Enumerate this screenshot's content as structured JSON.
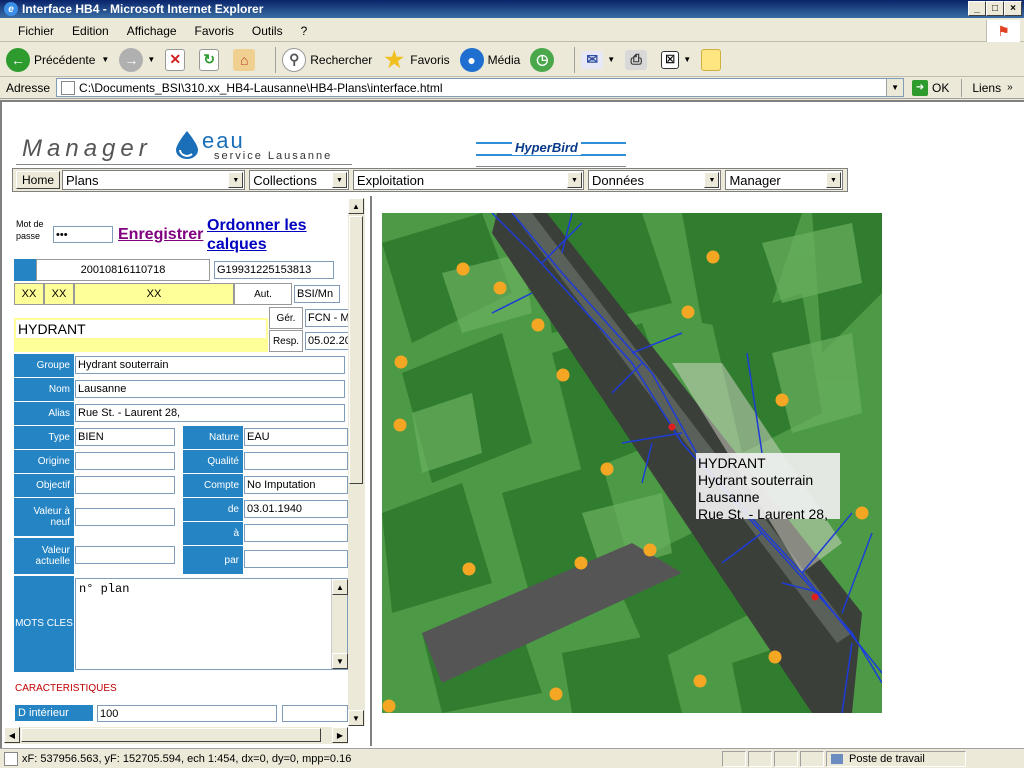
{
  "window": {
    "title": "Interface HB4 - Microsoft Internet Explorer",
    "controls": [
      "_",
      "□",
      "×"
    ]
  },
  "menubar": [
    "Fichier",
    "Edition",
    "Affichage",
    "Favoris",
    "Outils",
    "?"
  ],
  "toolbar": {
    "back": "Précédente",
    "search": "Rechercher",
    "favorites": "Favoris",
    "media": "Média"
  },
  "address": {
    "label": "Adresse",
    "url": "C:\\Documents_BSI\\310.xx_HB4-Lausanne\\HB4-Plans\\interface.html",
    "go": "OK",
    "links": "Liens"
  },
  "header": {
    "manager": "Manager",
    "eau": "eau",
    "service": "service Lausanne",
    "hyperbird": "HyperBird"
  },
  "nav": {
    "home": "Home",
    "selects": [
      "Plans",
      "Collections",
      "Exploitation",
      "Données",
      "Manager"
    ]
  },
  "form": {
    "password_label": "Mot de passe",
    "password_value": "•••",
    "save_link": "Enregistrer",
    "layers_link": "Ordonner les calques",
    "id1": "20010816110718",
    "id2": "G19931225153813",
    "xx": [
      "XX",
      "XX",
      "XX"
    ],
    "aut_label": "Aut.",
    "aut_value": "BSI/Mn",
    "object_name": "HYDRANT",
    "ger_label": "Gér.",
    "ger_value": "FCN  -  M",
    "resp_label": "Resp.",
    "resp_value": "05.02.20",
    "groupe_label": "Groupe",
    "groupe_value": "Hydrant souterrain",
    "nom_label": "Nom",
    "nom_value": "Lausanne",
    "alias_label": "Alias",
    "alias_value": "Rue St. - Laurent 28,",
    "type_label": "Type",
    "type_value": "BIEN",
    "nature_label": "Nature",
    "nature_value": "EAU",
    "origine_label": "Origine",
    "origine_value": "",
    "qualite_label": "Qualité",
    "qualite_value": "",
    "objectif_label": "Objectif",
    "objectif_value": "",
    "compte_label": "Compte",
    "compte_value": "No Imputation",
    "valeur_neuf_label": "Valeur à neuf",
    "valeur_neuf_value": "",
    "de_label": "de",
    "de_value": "03.01.1940",
    "a_label": "à",
    "a_value": "",
    "valeur_actuelle_label": "Valeur actuelle",
    "valeur_actuelle_value": "",
    "par_label": "par",
    "par_value": "",
    "mots_cles_label": "MOTS CLES",
    "mots_cles_value": "n° plan",
    "caracteristiques": "CARACTERISTIQUES",
    "d_interieur_label": "D intérieur",
    "d_interieur_value": "100"
  },
  "map": {
    "tooltip": [
      "HYDRANT",
      "Hydrant souterrain",
      "Lausanne",
      "Rue St. - Laurent 28,"
    ],
    "hydrant_color": "#f5a623",
    "selected_color": "#e02020",
    "pipe_color": "#1e3cd8"
  },
  "status": {
    "coords": "xF: 537956.563, yF: 152705.594, ech 1:454, dx=0, dy=0, mpp=0.16",
    "zone": "Poste de travail"
  }
}
